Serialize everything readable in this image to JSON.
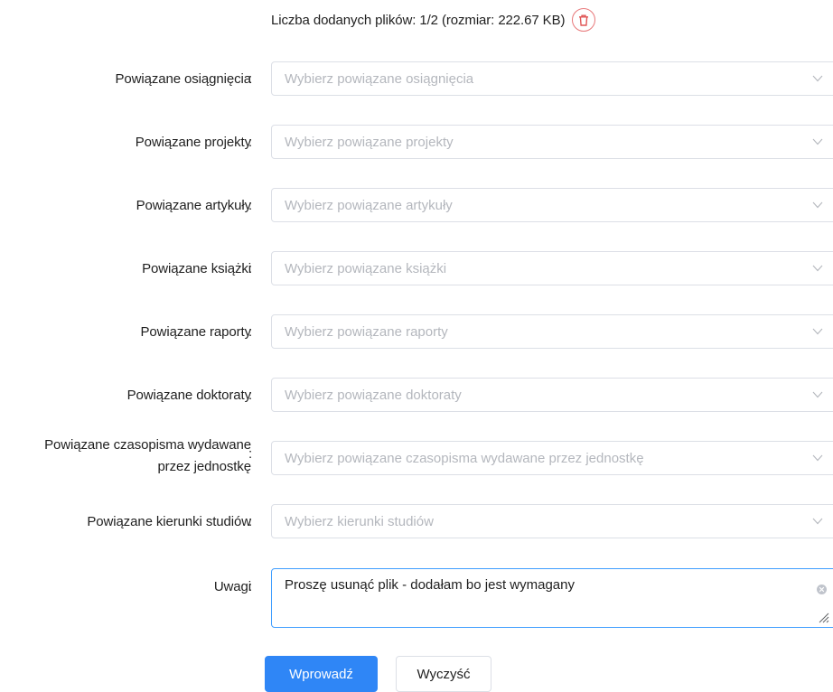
{
  "file_info": {
    "text": "Liczba dodanych plików: 1/2 (rozmiar: 222.67 KB)"
  },
  "icons": {
    "delete": "trash-icon",
    "dropdown": "chevron-down-icon",
    "clear": "close-circle-icon",
    "resize": "resize-handle-icon"
  },
  "fields": [
    {
      "label": "Powiązane osiągnięcia",
      "placeholder": "Wybierz powiązane osiągnięcia"
    },
    {
      "label": "Powiązane projekty",
      "placeholder": "Wybierz powiązane projekty"
    },
    {
      "label": "Powiązane artykuły",
      "placeholder": "Wybierz powiązane artykuły"
    },
    {
      "label": "Powiązane książki",
      "placeholder": "Wybierz powiązane książki"
    },
    {
      "label": "Powiązane raporty",
      "placeholder": "Wybierz powiązane raporty"
    },
    {
      "label": "Powiązane doktoraty",
      "placeholder": "Wybierz powiązane doktoraty"
    },
    {
      "label_line1": "Powiązane czasopisma wydawane",
      "label_line2": "przez jednostkę",
      "placeholder": "Wybierz powiązane czasopisma wydawane przez jednostkę"
    },
    {
      "label": "Powiązane kierunki studiów",
      "placeholder": "Wybierz kierunki studiów"
    }
  ],
  "colon": ":",
  "remarks": {
    "label": "Uwagi",
    "value": "Proszę usunąć plik - dodałam bo jest wymagany"
  },
  "buttons": {
    "submit": "Wprowadź",
    "clear": "Wyczyść"
  },
  "colors": {
    "primary": "#2f86f6",
    "danger": "#e8787a",
    "focus_border": "#409eff",
    "placeholder": "#b4b7bd"
  }
}
